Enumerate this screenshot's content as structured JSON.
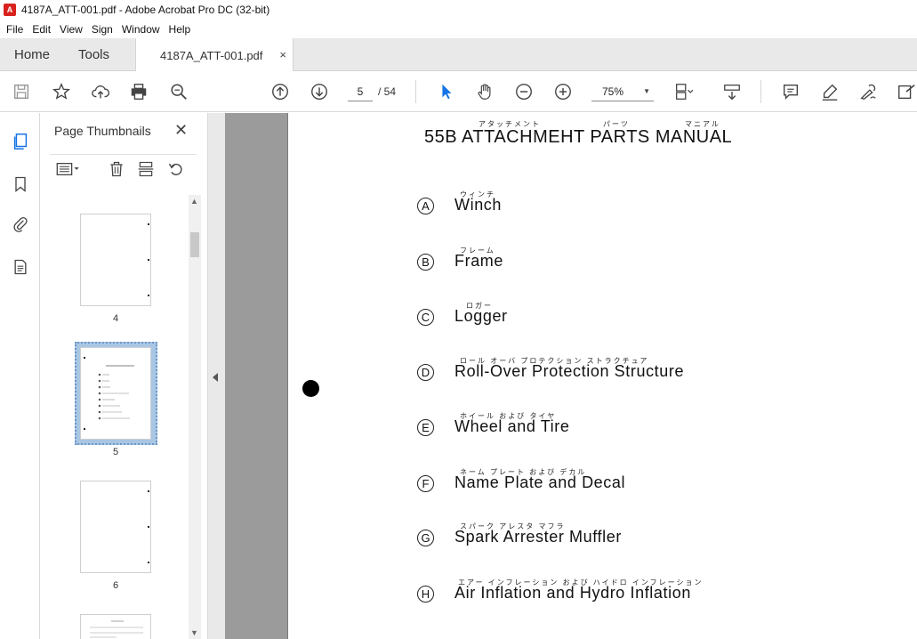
{
  "window": {
    "title": "4187A_ATT-001.pdf - Adobe Acrobat Pro DC (32-bit)"
  },
  "menu": [
    "File",
    "Edit",
    "View",
    "Sign",
    "Window",
    "Help"
  ],
  "tabs": {
    "home": "Home",
    "tools": "Tools",
    "document": "4187A_ATT-001.pdf",
    "close": "×"
  },
  "toolbar": {
    "current_page": "5",
    "total_pages": "/ 54",
    "zoom": "75%"
  },
  "thumbnails": {
    "title": "Page Thumbnails",
    "close": "✕",
    "pages": [
      {
        "label": "4"
      },
      {
        "label": "5"
      },
      {
        "label": "6"
      }
    ]
  },
  "document": {
    "heading": "55B ATTACHMEHT PARTS MANUAL",
    "heading_furigana": [
      "アタッチメント",
      "パーツ",
      "マニアル"
    ],
    "entries": [
      {
        "letter": "A",
        "text": "Winch",
        "furigana": "ウィンチ"
      },
      {
        "letter": "B",
        "text": "Frame",
        "furigana": "フレーム"
      },
      {
        "letter": "C",
        "text": "Logger",
        "furigana": "ロガー"
      },
      {
        "letter": "D",
        "text": "Roll-Over Protection Structure",
        "furigana": "ロール オーバ プロテクション ストラクチュア"
      },
      {
        "letter": "E",
        "text": "Wheel and Tire",
        "furigana": "ホイール および タイヤ"
      },
      {
        "letter": "F",
        "text": "Name Plate and Decal",
        "furigana": "ネーム プレート および デカル"
      },
      {
        "letter": "G",
        "text": "Spark Arrester Muffler",
        "furigana": "スパーク アレスタ マフラ"
      },
      {
        "letter": "H",
        "text": "Air Inflation and Hydro Inflation",
        "furigana": "エアー インフレーション および ハイドロ インフレーション"
      }
    ]
  },
  "colors": {
    "acrobat_red": "#d8221b",
    "accent_blue": "#1473e6",
    "selection": "#a9c6e3"
  }
}
